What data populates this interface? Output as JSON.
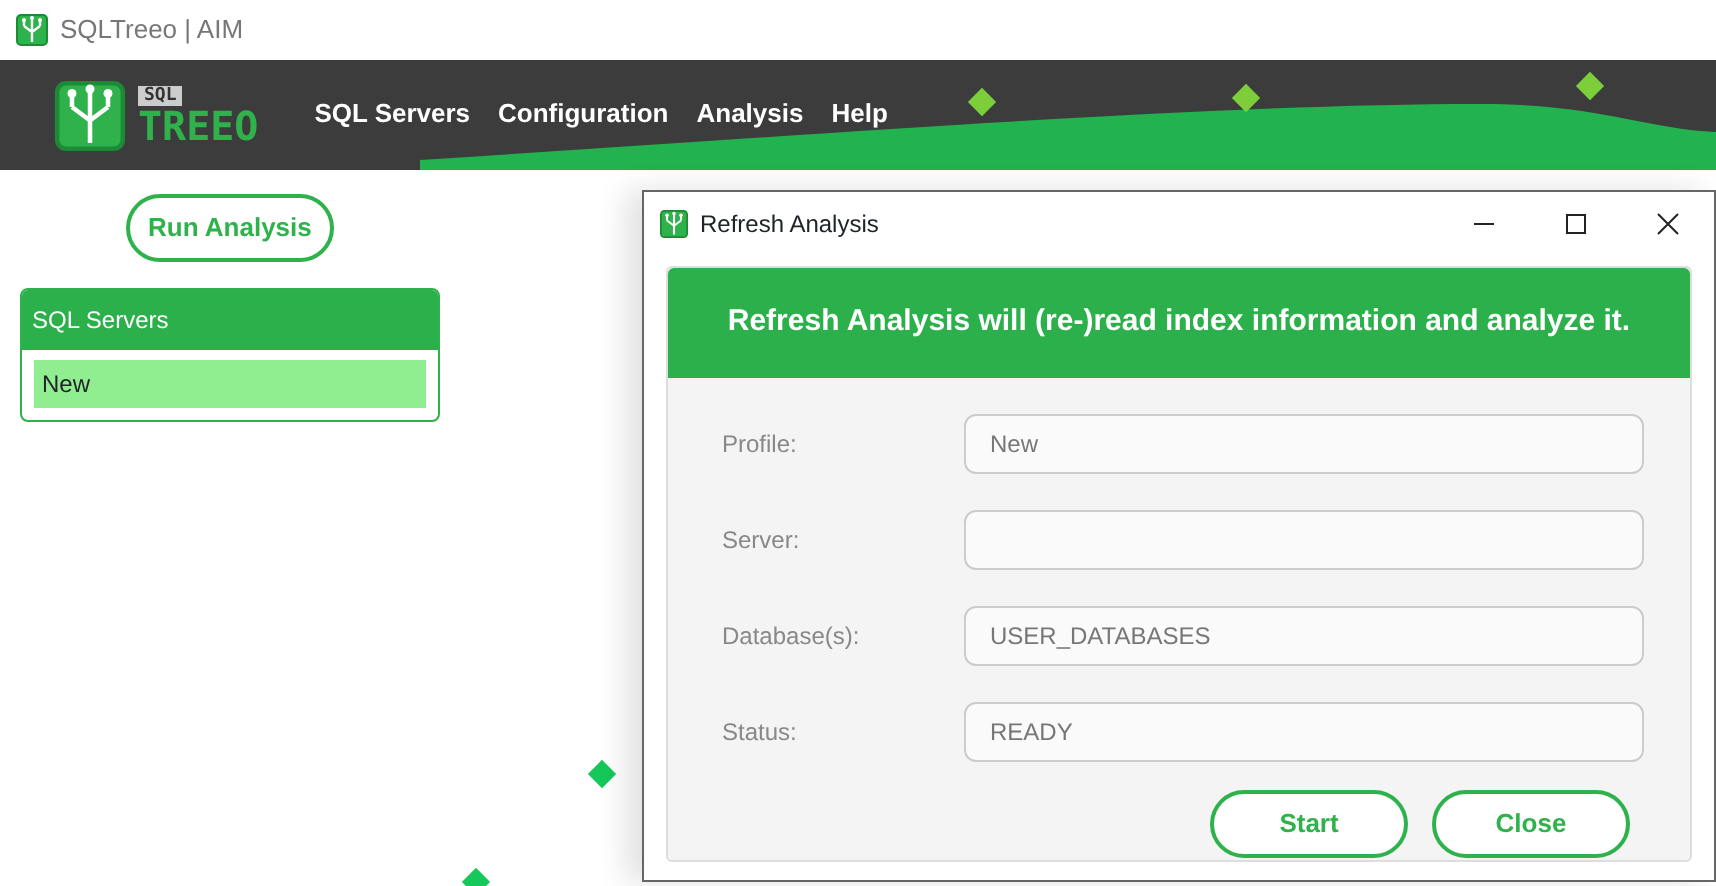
{
  "window": {
    "title": "SQLTreeo | AIM"
  },
  "logo": {
    "badge": "SQL",
    "wordmark": "TREEO"
  },
  "nav": {
    "items": [
      {
        "label": "SQL Servers"
      },
      {
        "label": "Configuration"
      },
      {
        "label": "Analysis"
      },
      {
        "label": "Help"
      }
    ]
  },
  "run_button": {
    "label": "Run Analysis"
  },
  "servers_panel": {
    "title": "SQL Servers",
    "items": [
      {
        "label": "New",
        "selected": true
      }
    ]
  },
  "dialog": {
    "title": "Refresh Analysis",
    "banner": "Refresh Analysis will (re-)read index information and analyze it.",
    "fields": [
      {
        "label": "Profile:",
        "value": "New"
      },
      {
        "label": "Server:"
      },
      {
        "label": "Database(s):",
        "value": "USER_DATABASES"
      },
      {
        "label": "Status:",
        "value": "READY"
      }
    ],
    "buttons": [
      {
        "label": "Start"
      },
      {
        "label": "Close"
      }
    ]
  }
}
